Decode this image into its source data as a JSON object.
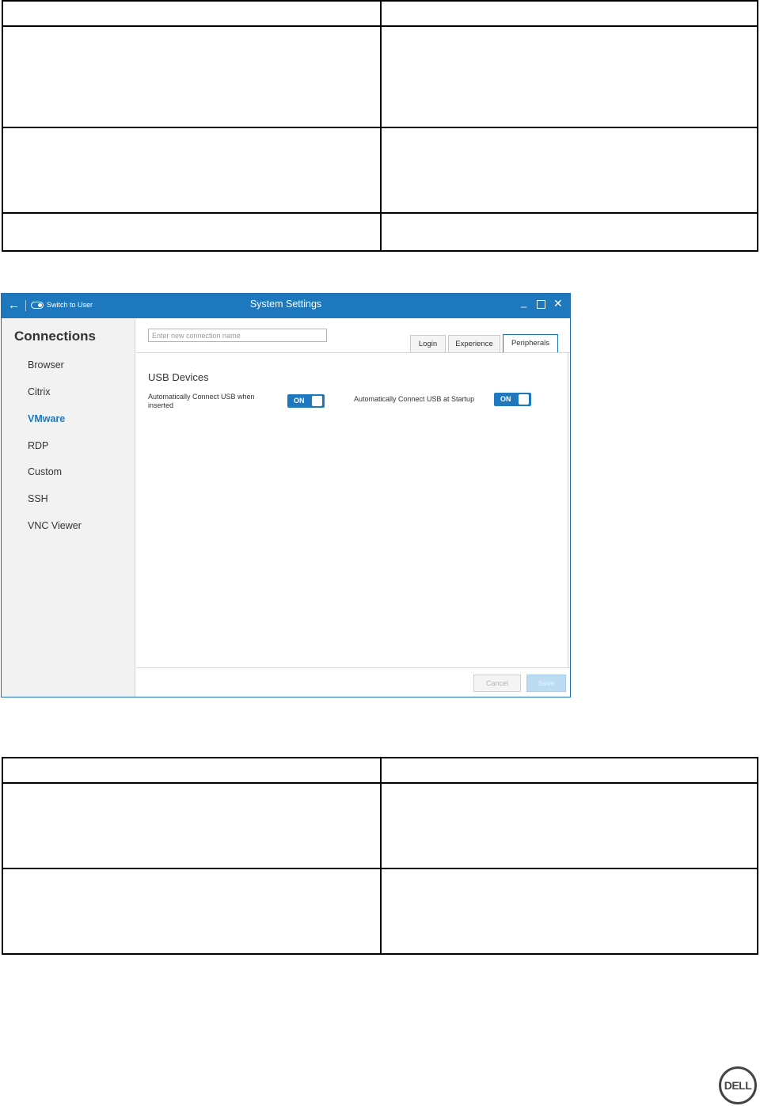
{
  "window": {
    "title": "System Settings",
    "switch_label": "Switch to User",
    "back_icon": "arrow-left-icon",
    "controls": {
      "minimize": "_",
      "maximize": "□",
      "close": "✕"
    },
    "accent": "#1e78be"
  },
  "sidebar": {
    "heading": "Connections",
    "items": [
      {
        "label": "Browser"
      },
      {
        "label": "Citrix"
      },
      {
        "label": "VMware"
      },
      {
        "label": "RDP"
      },
      {
        "label": "Custom"
      },
      {
        "label": "SSH"
      },
      {
        "label": "VNC Viewer"
      }
    ],
    "active": "VMware"
  },
  "main": {
    "connection_name": {
      "value": "",
      "placeholder": "Enter new connection name"
    },
    "tabs": [
      {
        "label": "Login"
      },
      {
        "label": "Experience"
      },
      {
        "label": "Peripherals"
      }
    ],
    "active_tab": "Peripherals",
    "section_title": "USB Devices",
    "options": [
      {
        "label": "Automatically Connect USB when inserted",
        "state": "ON"
      },
      {
        "label": "Automatically Connect USB at Startup",
        "state": "ON"
      }
    ]
  },
  "footer": {
    "cancel_label": "Cancel",
    "save_label": "Save"
  },
  "logo": {
    "text": "DELL"
  }
}
